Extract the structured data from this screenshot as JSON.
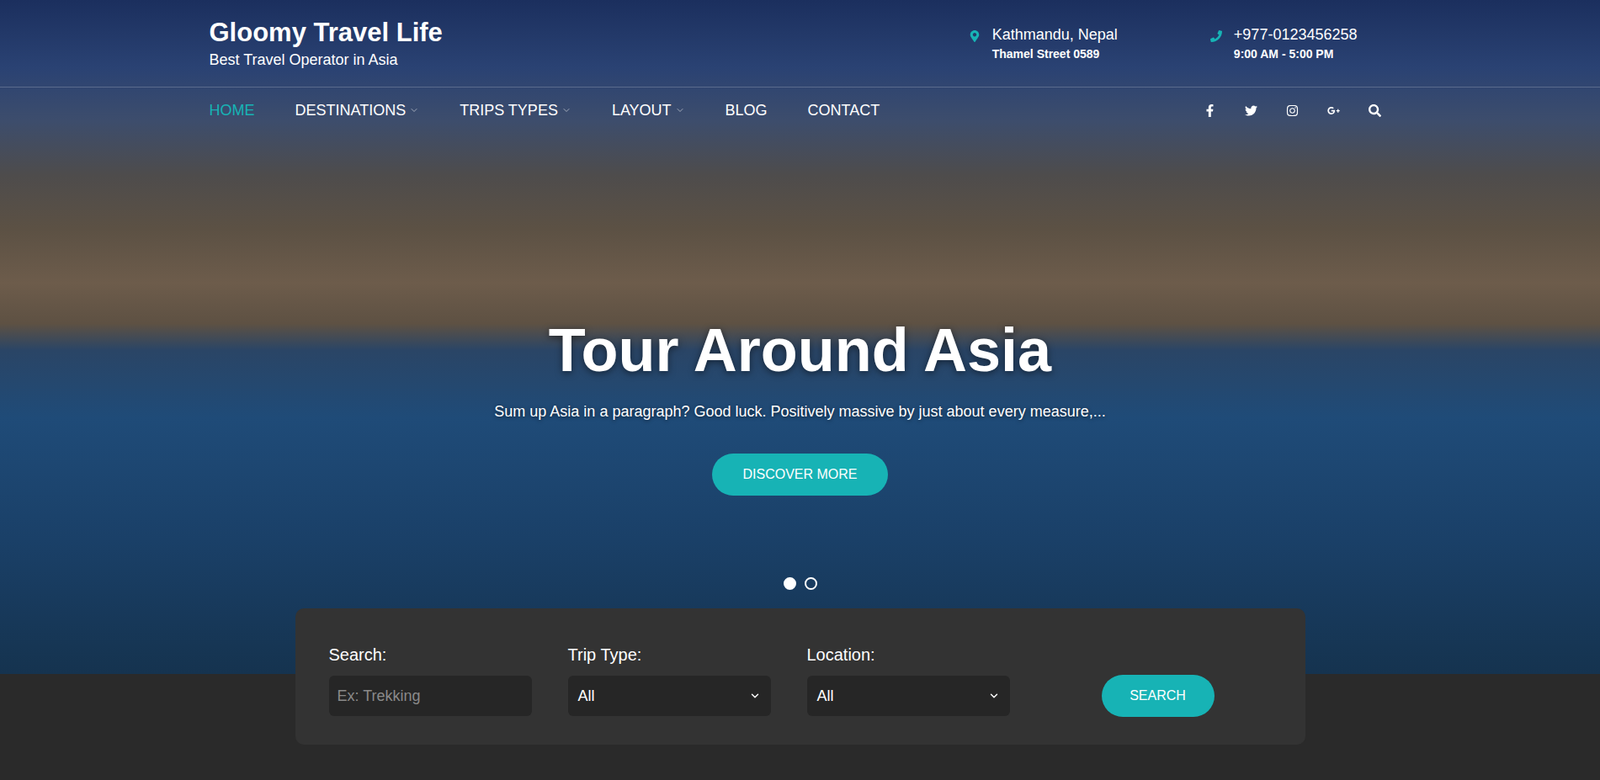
{
  "brand": {
    "title": "Gloomy Travel Life",
    "tagline": "Best Travel Operator in Asia"
  },
  "contacts": [
    {
      "kind": "location",
      "line1": "Kathmandu, Nepal",
      "line2": "Thamel Street 0589"
    },
    {
      "kind": "phone",
      "line1": "+977-0123456258",
      "line2": "9:00 AM - 5:00 PM"
    }
  ],
  "nav": [
    {
      "label": "HOME",
      "selected": true,
      "dropdown": false
    },
    {
      "label": "DESTINATIONS",
      "selected": false,
      "dropdown": true
    },
    {
      "label": "TRIPS TYPES",
      "selected": false,
      "dropdown": true
    },
    {
      "label": "LAYOUT",
      "selected": false,
      "dropdown": true
    },
    {
      "label": "BLOG",
      "selected": false,
      "dropdown": false
    },
    {
      "label": "CONTACT",
      "selected": false,
      "dropdown": false
    }
  ],
  "slider": {
    "title": "Tour Around Asia",
    "text": "Sum up Asia in a paragraph? Good luck. Positively massive by just about every measure,...",
    "button": "DISCOVER MORE",
    "slides": [
      {
        "selected": true
      },
      {
        "selected": false
      }
    ]
  },
  "search_form": {
    "fields": [
      {
        "kind": "text",
        "label": "Search:",
        "placeholder": "Ex: Trekking"
      },
      {
        "kind": "select",
        "label": "Trip Type:",
        "value": "All"
      },
      {
        "kind": "select",
        "label": "Location:",
        "value": "All"
      }
    ],
    "button": "SEARCH"
  }
}
